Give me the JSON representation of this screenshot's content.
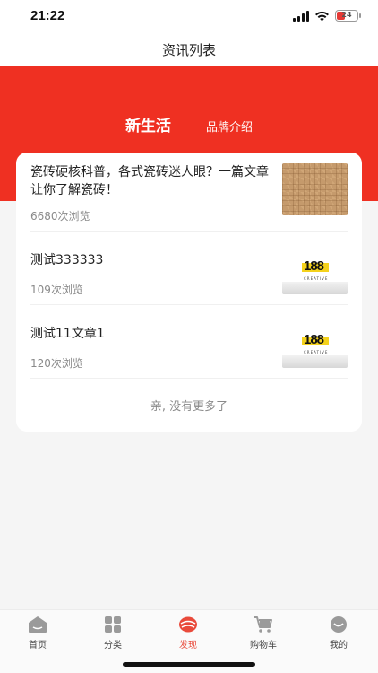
{
  "status_bar": {
    "time": "21:22",
    "battery": "24"
  },
  "nav": {
    "title": "资讯列表"
  },
  "hero": {
    "tabs": [
      {
        "label": "新生活",
        "active": true
      },
      {
        "label": "品牌介绍",
        "active": false
      }
    ],
    "color": "#ef3022"
  },
  "articles": [
    {
      "title": "瓷砖硬核科普，各式瓷砖迷人眼？一篇文章让你了解瓷砖！",
      "views": "6680次浏览",
      "thumb": "tile-texture"
    },
    {
      "title": "测试333333",
      "views": "109次浏览",
      "thumb": "188-logo"
    },
    {
      "title": "测试11文章1",
      "views": "120次浏览",
      "thumb": "188-logo"
    }
  ],
  "logo": {
    "text": "188",
    "sub": "CREATIVE"
  },
  "list_end": "亲, 没有更多了",
  "tabbar": {
    "items": [
      {
        "label": "首页",
        "icon": "home-icon"
      },
      {
        "label": "分类",
        "icon": "grid-icon"
      },
      {
        "label": "发现",
        "icon": "discover-icon",
        "active": true
      },
      {
        "label": "购物车",
        "icon": "cart-icon"
      },
      {
        "label": "我的",
        "icon": "profile-icon"
      }
    ],
    "active_color": "#e94a3b"
  }
}
